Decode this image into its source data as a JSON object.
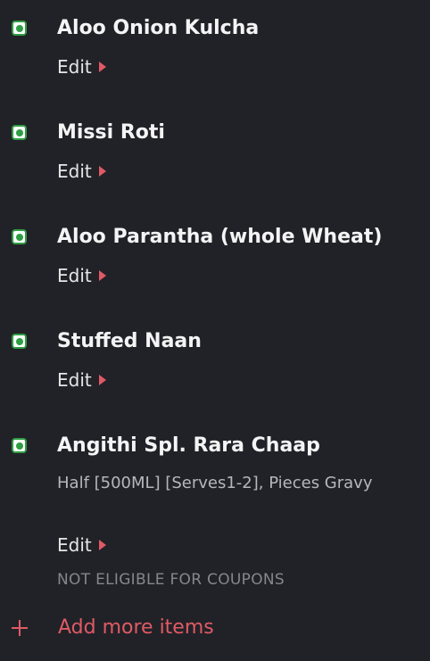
{
  "cart": {
    "edit_label": "Edit",
    "items": [
      {
        "name": "Aloo Onion Kulcha",
        "type": "veg"
      },
      {
        "name": "Missi Roti",
        "type": "veg"
      },
      {
        "name": "Aloo Parantha (whole Wheat)",
        "type": "veg"
      },
      {
        "name": "Stuffed Naan",
        "type": "veg"
      },
      {
        "name": "Angithi Spl. Rara Chaap",
        "type": "veg",
        "description": "Half [500ML] [Serves1-2], Pieces Gravy",
        "note": "NOT ELIGIBLE FOR COUPONS"
      }
    ],
    "add_more_label": "Add more items"
  },
  "colors": {
    "background": "#212227",
    "veg_green": "#2f9d44",
    "accent_red": "#e05a66",
    "muted_text": "#85868e"
  },
  "icons": {
    "veg": "veg-indicator-icon",
    "edit": "caret-right-icon",
    "add": "plus-icon"
  }
}
